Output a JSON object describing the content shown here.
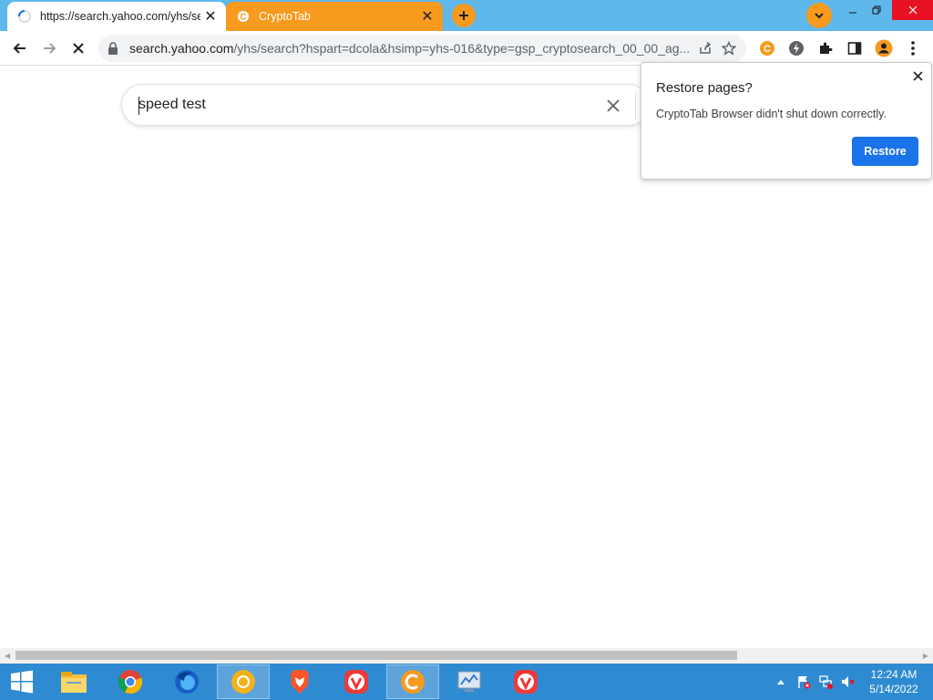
{
  "browser": {
    "tabs": [
      {
        "title": "https://search.yahoo.com/yhs/se",
        "active": true
      },
      {
        "title": "CryptoTab",
        "active": false
      }
    ],
    "url_host": "search.yahoo.com",
    "url_rest": "/yhs/search?hspart=dcola&hsimp=yhs-016&type=gsp_cryptosearch_00_00_ag..."
  },
  "page": {
    "search_query": "speed test"
  },
  "popup": {
    "title": "Restore pages?",
    "message": "CryptoTab Browser didn't shut down correctly.",
    "restore_label": "Restore"
  },
  "taskbar": {
    "apps": [
      "start-icon",
      "file-explorer-icon",
      "chrome-icon",
      "firefox-icon",
      "chromium-icon",
      "brave-icon",
      "vivaldi-icon",
      "cryptotab-icon",
      "control-panel-icon",
      "vivaldi-icon"
    ],
    "time": "12:24 AM",
    "date": "5/14/2022"
  },
  "colors": {
    "tab_strip": "#5eb8ec",
    "accent_orange": "#f79a1e",
    "restore_button": "#1a73e8",
    "taskbar": "#2f8bd1"
  }
}
